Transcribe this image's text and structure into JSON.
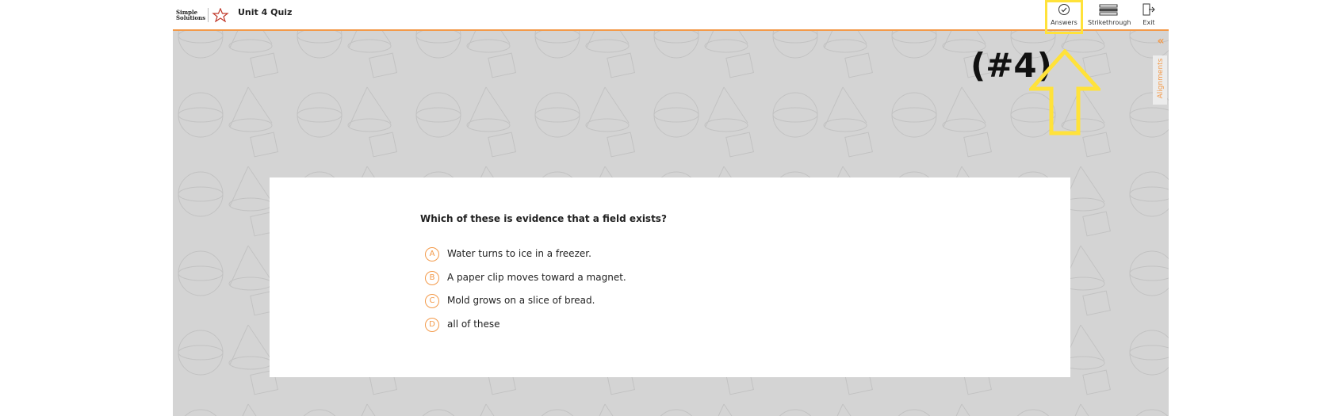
{
  "header": {
    "logo_alt": "Simple Solutions",
    "title": "Unit 4 Quiz"
  },
  "toolbar": {
    "answers_label": "Answers",
    "strikethrough_label": "Strikethrough",
    "exit_label": "Exit"
  },
  "side": {
    "alignments_label": "Alignments",
    "collapse_icon": "double-chevron-left-icon"
  },
  "question": {
    "text": "Which of these is evidence that a field exists?",
    "choices": [
      {
        "letter": "A",
        "text": "Water turns to ice in a freezer."
      },
      {
        "letter": "B",
        "text": "A paper clip moves toward a magnet."
      },
      {
        "letter": "C",
        "text": "Mold grows on a slice of bread."
      },
      {
        "letter": "D",
        "text": "all of these"
      }
    ]
  },
  "annotation": {
    "label": "(#4)",
    "highlight_color": "#ffe23a"
  },
  "colors": {
    "accent": "#f39a4a",
    "background": "#d4d4d4"
  }
}
